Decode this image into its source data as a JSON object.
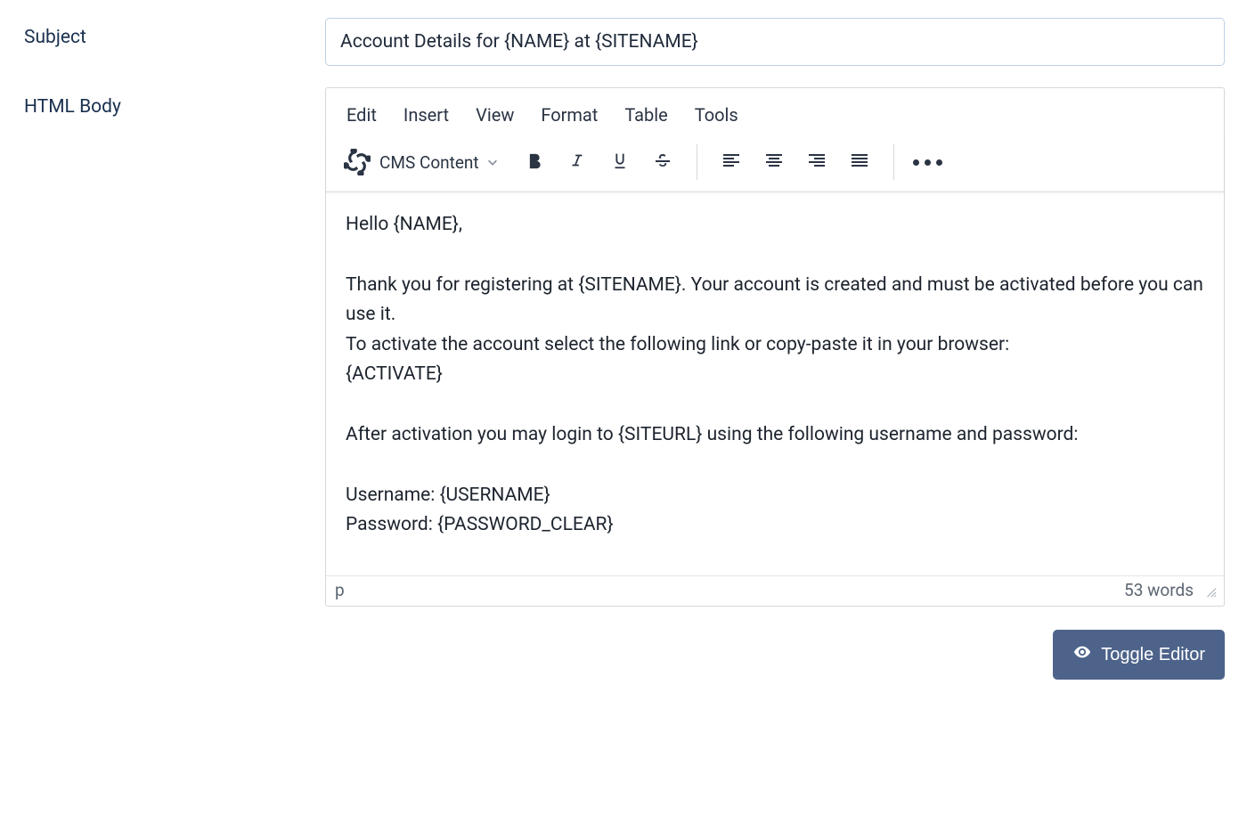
{
  "labels": {
    "subject": "Subject",
    "html_body": "HTML Body"
  },
  "subject_value": "Account Details for {NAME} at {SITENAME}",
  "editor": {
    "menubar": {
      "edit": "Edit",
      "insert": "Insert",
      "view": "View",
      "format": "Format",
      "table": "Table",
      "tools": "Tools"
    },
    "toolbar": {
      "cms_content_label": "CMS Content"
    },
    "body_lines": [
      "Hello {NAME},",
      "",
      "Thank you for registering at {SITENAME}. Your account is created and must be activated before you can use it.",
      "To activate the account select the following link or copy-paste it in your browser:",
      "{ACTIVATE}",
      "",
      "After activation you may login to {SITEURL} using the following username and password:",
      "",
      "Username: {USERNAME}",
      "Password: {PASSWORD_CLEAR}"
    ],
    "statusbar": {
      "path": "p",
      "word_count": "53 words"
    }
  },
  "buttons": {
    "toggle_editor": "Toggle Editor"
  }
}
